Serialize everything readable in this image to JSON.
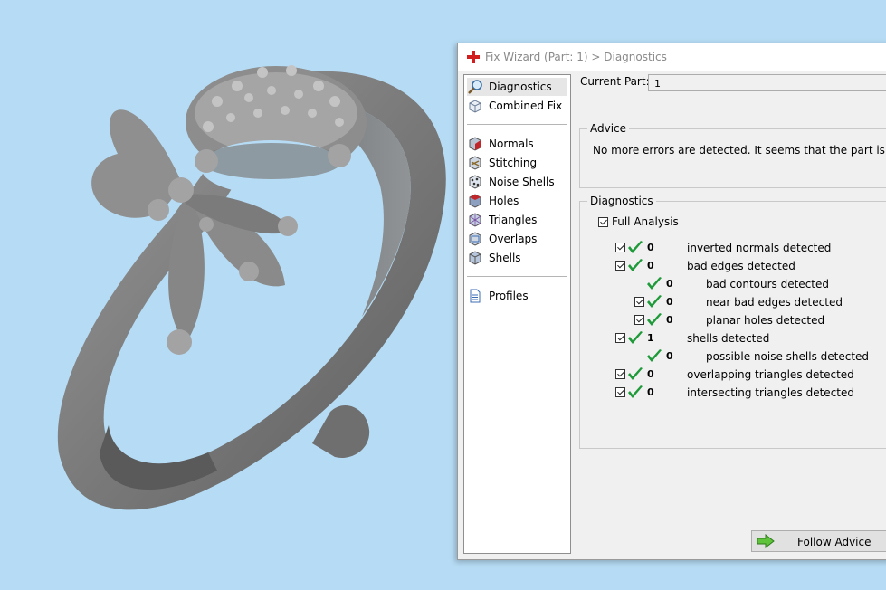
{
  "window": {
    "title": "Fix Wizard (Part: 1) > Diagnostics"
  },
  "nav": {
    "top": [
      {
        "label": "Diagnostics",
        "icon": "magnifier-icon",
        "selected": true
      },
      {
        "label": "Combined Fix",
        "icon": "combined-fix-icon"
      }
    ],
    "tools": [
      {
        "label": "Normals",
        "icon": "normals-icon"
      },
      {
        "label": "Stitching",
        "icon": "stitching-icon"
      },
      {
        "label": "Noise Shells",
        "icon": "noise-shells-icon"
      },
      {
        "label": "Holes",
        "icon": "holes-icon"
      },
      {
        "label": "Triangles",
        "icon": "triangles-icon"
      },
      {
        "label": "Overlaps",
        "icon": "overlaps-icon"
      },
      {
        "label": "Shells",
        "icon": "shells-icon"
      }
    ],
    "bottom": [
      {
        "label": "Profiles",
        "icon": "document-icon"
      }
    ]
  },
  "current_part": {
    "label": "Current Part:",
    "value": "1"
  },
  "advice": {
    "title": "Advice",
    "text": "No more errors are detected. It seems that the part is ok."
  },
  "diagnostics": {
    "title": "Diagnostics",
    "full_analysis": {
      "label": "Full Analysis",
      "checked": true
    },
    "rows": [
      {
        "count": "0",
        "label": "inverted normals detected",
        "checked": true,
        "indent": false
      },
      {
        "count": "0",
        "label": "bad edges detected",
        "checked": true,
        "indent": false
      },
      {
        "count": "0",
        "label": "bad contours detected",
        "checked": null,
        "indent": true
      },
      {
        "count": "0",
        "label": "near bad edges detected",
        "checked": true,
        "indent": true
      },
      {
        "count": "0",
        "label": "planar holes detected",
        "checked": true,
        "indent": true
      },
      {
        "count": "1",
        "label": "shells detected",
        "checked": true,
        "indent": false
      },
      {
        "count": "0",
        "label": "possible noise shells detected",
        "checked": null,
        "indent": true
      },
      {
        "count": "0",
        "label": "overlapping triangles detected",
        "checked": true,
        "indent": false
      },
      {
        "count": "0",
        "label": "intersecting triangles detected",
        "checked": true,
        "indent": false
      }
    ]
  },
  "follow_advice": {
    "label": "Follow Advice"
  }
}
